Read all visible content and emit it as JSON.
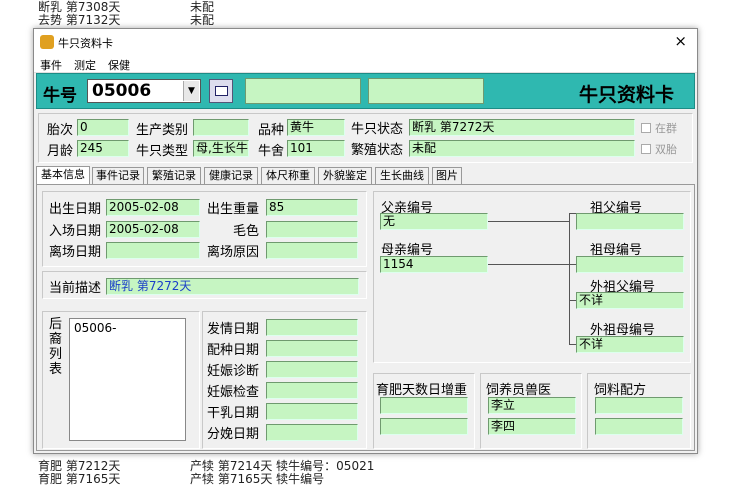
{
  "background_rows": [
    {
      "a": "断乳 第7308天",
      "b": "未配"
    },
    {
      "a": "去势 第7132天",
      "b": "未配"
    },
    {
      "a": "育肥 第7212天",
      "b": "产犊 第7214天 犊牛编号：05021"
    },
    {
      "a": "育肥 第7165天",
      "b": "产犊 第7165天 犊牛编号"
    }
  ],
  "window": {
    "title": "牛只资料卡",
    "close": "×"
  },
  "menu": [
    "事件",
    "测定",
    "保健"
  ],
  "header": {
    "id_label": "牛号",
    "id_value": "05006",
    "card_title": "牛只资料卡"
  },
  "info": {
    "parity_label": "胎次",
    "parity": "0",
    "prod_cat_label": "生产类别",
    "prod_cat": "",
    "breed_label": "品种",
    "breed": "黄牛",
    "status_label": "牛只状态",
    "status": "断乳 第7272天",
    "age_label": "月龄",
    "age": "245",
    "type_label": "牛只类型",
    "type": "母,生长牛",
    "barn_label": "牛舍",
    "barn": "101",
    "breed_status_label": "繁殖状态",
    "breed_status": "未配",
    "in_herd": "在群",
    "twin": "双胎"
  },
  "tabs": [
    "基本信息",
    "事件记录",
    "繁殖记录",
    "健康记录",
    "体尺称重",
    "外貌鉴定",
    "生长曲线",
    "图片"
  ],
  "basic": {
    "birth_date_label": "出生日期",
    "birth_date": "2005-02-08",
    "entry_date_label": "入场日期",
    "entry_date": "2005-02-08",
    "leave_date_label": "离场日期",
    "leave_date": "",
    "birth_weight_label": "出生重量",
    "birth_weight": "85",
    "color_label": "毛色",
    "color": "",
    "leave_reason_label": "离场原因",
    "leave_reason": "",
    "desc_label": "当前描述",
    "desc": "断乳 第7272天",
    "offspring_label": "后裔列表",
    "offspring": [
      "05006-"
    ],
    "estrus_label": "发情日期",
    "mating_label": "配种日期",
    "preg_diag_label": "妊娠诊断",
    "preg_check_label": "妊娠检查",
    "dry_label": "干乳日期",
    "calving_label": "分娩日期"
  },
  "pedigree": {
    "father_label": "父亲编号",
    "father": "无",
    "mother_label": "母亲编号",
    "mother": "1154",
    "ff_label": "祖父编号",
    "ff": "",
    "fm_label": "祖母编号",
    "fm": "",
    "mf_label": "外祖父编号",
    "mf": "不详",
    "mm_label": "外祖母编号",
    "mm": "不详"
  },
  "bottom": {
    "fatten_label": "育肥天数日增重",
    "keeper_label": "饲养员兽医",
    "keeper1": "李立",
    "keeper2": "李四",
    "feed_label": "饲料配方"
  }
}
